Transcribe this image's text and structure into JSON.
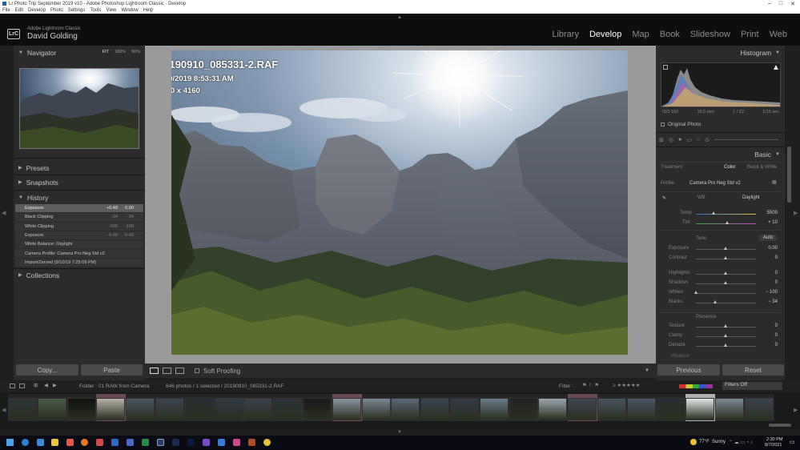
{
  "window": {
    "title": "Lr Photo Trip September 2019 v10 - Adobe Photoshop Lightroom Classic - Develop",
    "controls": [
      "–",
      "□",
      "✕"
    ]
  },
  "menu": [
    "File",
    "Edit",
    "Develop",
    "Photo",
    "Settings",
    "Tools",
    "View",
    "Window",
    "Help"
  ],
  "identity": {
    "logo": "LrC",
    "product": "Adobe Lightroom Classic",
    "user": "David Golding"
  },
  "modules": [
    "Library",
    "Develop",
    "Map",
    "Book",
    "Slideshow",
    "Print",
    "Web"
  ],
  "active_module": "Develop",
  "left_panel": {
    "navigator": {
      "title": "Navigator",
      "zoom_options": [
        "FIT",
        "100%",
        "50%"
      ],
      "active_zoom": "FIT"
    },
    "presets": "Presets",
    "snapshots": "Snapshots",
    "history": {
      "title": "History",
      "rows": [
        {
          "label": "Exposure",
          "delta": "+0.49",
          "value": "0.00",
          "selected": true
        },
        {
          "label": "Black Clipping",
          "delta": "-34",
          "value": "-34",
          "selected": false
        },
        {
          "label": "White Clipping",
          "delta": "-100",
          "value": "-100",
          "selected": false
        },
        {
          "label": "Exposure",
          "delta": "-0.49",
          "value": "-0.49",
          "selected": false
        },
        {
          "label": "White Balance: Daylight",
          "delta": "",
          "value": "",
          "selected": false
        },
        {
          "label": "Camera Profile: Camera Pro Neg Std v2",
          "delta": "",
          "value": "",
          "selected": false
        },
        {
          "label": "Import/Zeroed (9/10/19 7:25:09 PM)",
          "delta": "",
          "value": "",
          "selected": false
        }
      ]
    },
    "collections": "Collections",
    "copy_button": "Copy...",
    "paste_button": "Paste"
  },
  "photo": {
    "filename": "20190910_085331-2.RAF",
    "datetime": "9/10/2019 8:53:31 AM",
    "dimensions": "6240 x 4160"
  },
  "toolbar": {
    "soft_proofing": "Soft Proofing"
  },
  "right_panel": {
    "histogram": {
      "title": "Histogram",
      "iso": "ISO 160",
      "focal": "16.5 mm",
      "aperture": "ƒ / 22",
      "shutter": "1/15 sec"
    },
    "original_photo": "Original Photo",
    "basic": {
      "title": "Basic",
      "treatment_label": "Treatment",
      "treatment_options": [
        "Color",
        "Black & White"
      ],
      "active_treatment": "Color",
      "profile_label": "Profile",
      "profile_value": "Camera Pro Neg Std v2",
      "wb_label": "WB",
      "wb_value": "Daylight",
      "temp": {
        "label": "Temp",
        "value": "5500",
        "position": 0.3
      },
      "tint": {
        "label": "Tint",
        "value": "+ 10",
        "position": 0.53
      },
      "tone_label": "Tone",
      "auto_label": "Auto",
      "sliders": [
        {
          "label": "Exposure",
          "value": "0.00",
          "position": 0.5
        },
        {
          "label": "Contrast",
          "value": "0",
          "position": 0.5
        },
        {
          "label": "Highlights",
          "value": "0",
          "position": 0.5
        },
        {
          "label": "Shadows",
          "value": "0",
          "position": 0.5
        },
        {
          "label": "Whites",
          "value": "− 100",
          "position": 0.0
        },
        {
          "label": "Blacks",
          "value": "− 34",
          "position": 0.33
        }
      ],
      "presence_label": "Presence",
      "presence_sliders": [
        {
          "label": "Texture",
          "value": "0",
          "position": 0.5
        },
        {
          "label": "Clarity",
          "value": "0",
          "position": 0.5
        },
        {
          "label": "Dehaze",
          "value": "0",
          "position": 0.5
        }
      ],
      "vibrance_label": "Vibrance"
    },
    "previous_button": "Previous",
    "reset_button": "Reset"
  },
  "filmstrip": {
    "pages": [
      "1",
      "2"
    ],
    "folder_text": "Folder : 01 RAW from Camera",
    "count_text": "846 photos / 1 selected / 20190910_085331-2.RAF",
    "filter_label": "Filter :",
    "filters_off": "Filters Off"
  },
  "taskbar": {
    "weather_temp": "77°F",
    "weather_text": "Sunny",
    "time": "2:30 PM",
    "date": "8/7/2021"
  },
  "colors": {
    "accent_bg": "#2b2b2b",
    "identity_bg": "#0e0e0e",
    "history_selected": "#5d5d5d"
  }
}
